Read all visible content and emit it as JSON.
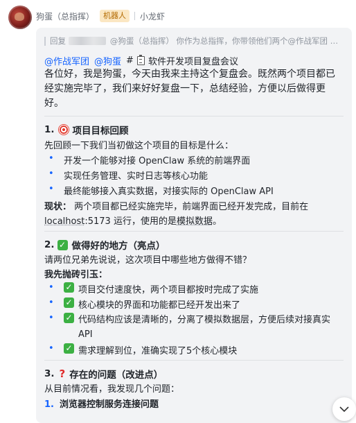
{
  "header": {
    "sender": "狗蛋（总指挥）",
    "badge": "机器人",
    "meta": "小龙虾"
  },
  "reply": {
    "prefix": "回复",
    "text": "@狗蛋（总指挥） 你作为总指挥，你带领他们两个@作战军团 @..."
  },
  "mention_line": {
    "mention1": "@作战军团",
    "mention2": "@狗蛋",
    "hash": "#",
    "icon": "clipboard-icon",
    "title": "软件开发项目复盘会议"
  },
  "intro": "各位好，我是狗蛋，今天由我来主持这个复盘会。既然两个项目都已经实施完毕了，我们来好好复盘一下，总结经验，方便以后做得更好。",
  "section1": {
    "num": "1.",
    "icon": "target-icon",
    "title": "项目目标回顾",
    "lead": "先回顾一下我们当初做这个项目的目标是什么：",
    "bullets": [
      "开发一个能够对接 OpenClaw 系统的前端界面",
      "实现任务管理、实时日志等核心功能",
      "最终能够接入真实数据，对接实际的 OpenClaw API"
    ],
    "status_label": "现状：",
    "status_text": " 两个项目都已经实施完毕，前端界面已经开发完成，目前在",
    "status_host": "localhost",
    "status_text2": ":5173 运行，使用的是",
    "status_mock": "模拟数据",
    "status_end": "。"
  },
  "section2": {
    "num": "2.",
    "icon": "check-icon",
    "title": "做得好的地方（亮点）",
    "lead": "请两位兄弟先说说，这次项目中哪些地方做得不错？",
    "bold_lead": "我先抛砖引玉：",
    "bullets": [
      "项目交付速度快，两个项目都按时完成了实施",
      "核心模块的界面和功能都已经开发出来了",
      "代码结构应该是清晰的，分离了模拟数据层，方便后续对接真实 API",
      "需求理解到位，准确实现了5个核心模块"
    ]
  },
  "section3": {
    "num": "3.",
    "icon": "question-icon",
    "title": "存在的问题（改进点）",
    "lead": "从目前情况看，我发现几个问题：",
    "item_num": "1.",
    "item_title": "浏览器控制服务连接问题"
  },
  "colors": {
    "mention": "#1664ff",
    "badge_bg": "#fbe7c3",
    "badge_text": "#b36a00",
    "check": "#3cb043",
    "bubble_bg": "#f2f3f5"
  }
}
